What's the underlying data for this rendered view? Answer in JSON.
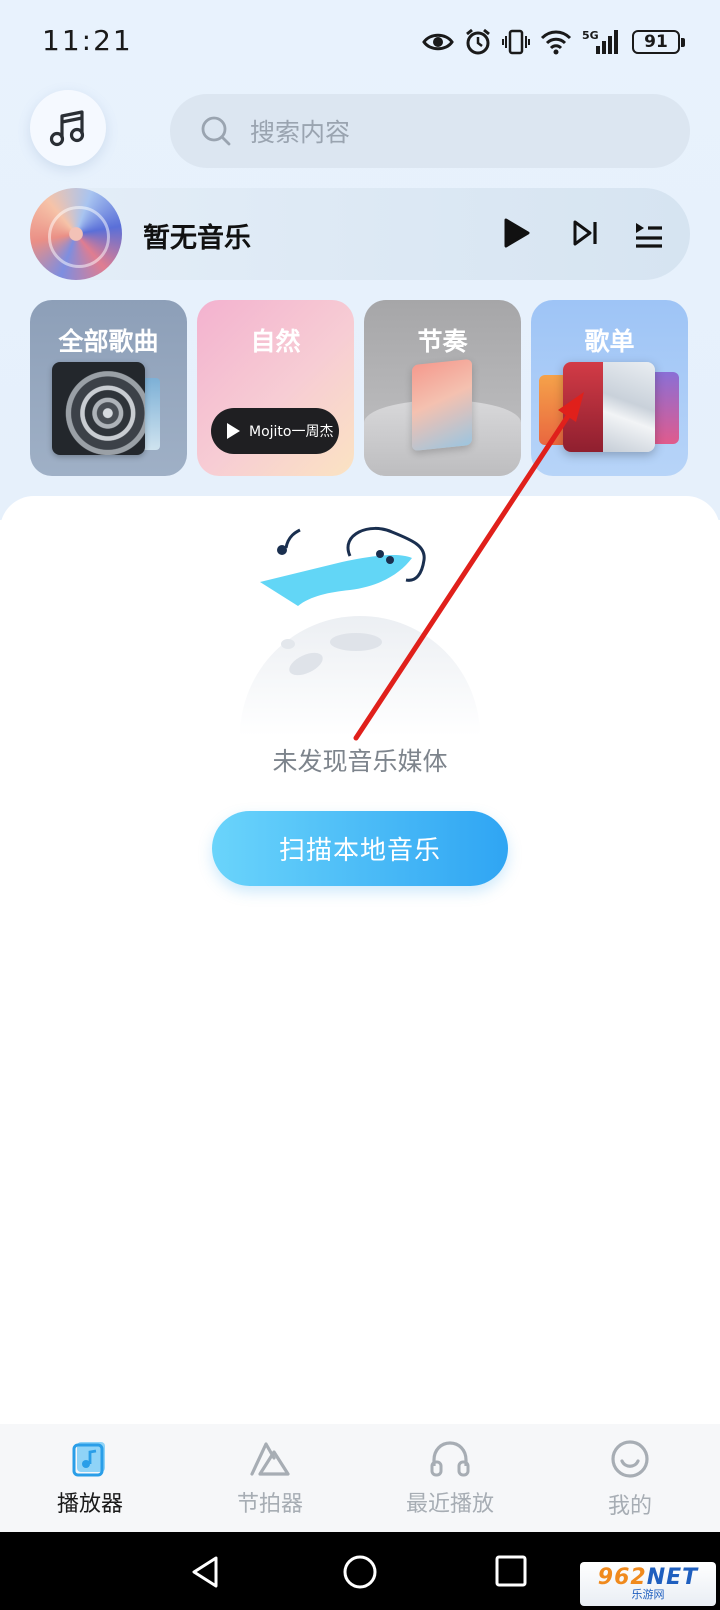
{
  "status_bar": {
    "time": "11:21",
    "battery": "91",
    "network": "5G"
  },
  "search": {
    "placeholder": "搜索内容"
  },
  "now_playing": {
    "title": "暂无音乐"
  },
  "categories": [
    {
      "label": "全部歌曲"
    },
    {
      "label": "自然",
      "track": "Mojito一周杰"
    },
    {
      "label": "节奏"
    },
    {
      "label": "歌单"
    }
  ],
  "empty_state": {
    "message": "未发现音乐媒体",
    "scan_button": "扫描本地音乐"
  },
  "bottom_nav": [
    {
      "label": "播放器",
      "icon": "player-icon",
      "active": true
    },
    {
      "label": "节拍器",
      "icon": "metronome-icon",
      "active": false
    },
    {
      "label": "最近播放",
      "icon": "headphones-icon",
      "active": false
    },
    {
      "label": "我的",
      "icon": "smile-icon",
      "active": false
    }
  ],
  "watermark": {
    "main_prefix": "962",
    "main_suffix": "NET",
    "sub": "乐游网"
  },
  "colors": {
    "accent_start": "#6ad4fb",
    "accent_end": "#2fa5f3",
    "annotation_arrow": "#e0201b",
    "active_nav": "#1a1a1a",
    "inactive_nav": "#a7adb4"
  }
}
